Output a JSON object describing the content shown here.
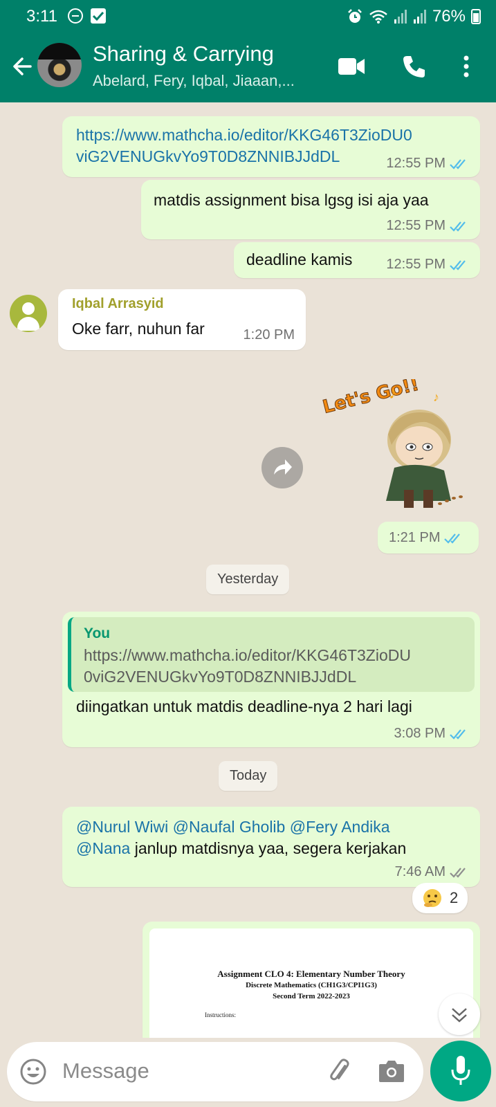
{
  "status_bar": {
    "time": "3:11",
    "battery": "76%"
  },
  "header": {
    "title": "Sharing & Carrying",
    "subtitle": "Abelard, Fery, Iqbal, Jiaaan,..."
  },
  "messages": {
    "m1": {
      "text_line1": "https://www.mathcha.io/editor/KKG46T3ZioDU0",
      "text_line2": "viG2VENUGkvYo9T0D8ZNNIBJJdDL",
      "time": "12:55 PM"
    },
    "m2": {
      "text": "matdis assignment bisa lgsg isi aja yaa",
      "time": "12:55 PM"
    },
    "m3": {
      "text": "deadline kamis",
      "time": "12:55 PM"
    },
    "m4": {
      "sender": "Iqbal Arrasyid",
      "text": "Oke farr, nuhun far",
      "time": "1:20 PM"
    },
    "m5": {
      "sticker_text": "Let's Go!!",
      "time": "1:21 PM"
    },
    "m6": {
      "quote_name": "You",
      "quote_line1": "https://www.mathcha.io/editor/KKG46T3ZioDU",
      "quote_line2": "0viG2VENUGkvYo9T0D8ZNNIBJJdDL",
      "text": "diingatkan untuk matdis deadline-nya 2 hari lagi",
      "time": "3:08 PM"
    },
    "m7": {
      "mentions_line1": "@Nurul Wiwi @Naufal Gholib @Fery Andika",
      "mention_line2": "@Nana",
      "text_line2": " janlup matdisnya yaa, segera kerjakan",
      "time": "7:46 AM",
      "reaction_count": "2"
    },
    "m8": {
      "doc_title": "Assignment CLO 4: Elementary Number Theory",
      "doc_course": "Discrete Mathematics (CH1G3/CPI1G3)",
      "doc_term": "Second Term 2022-2023",
      "doc_instructions": "Instructions:"
    }
  },
  "dates": {
    "yesterday": "Yesterday",
    "today": "Today"
  },
  "input": {
    "placeholder": "Message"
  },
  "colors": {
    "header": "#008069",
    "out_bubble": "#e7fcd6",
    "in_bubble": "#ffffff",
    "tick_read": "#53bdeb",
    "mic": "#00a884"
  }
}
